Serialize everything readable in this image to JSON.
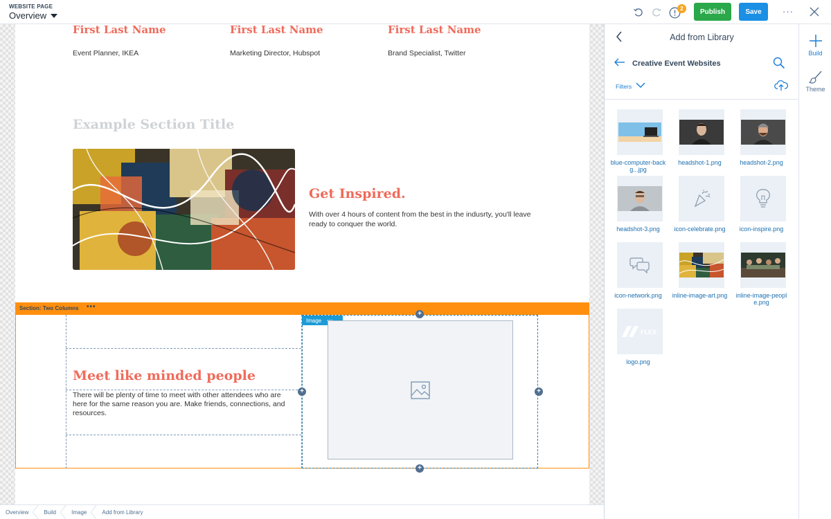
{
  "header": {
    "kicker": "WEBSITE PAGE",
    "page_select": "Overview",
    "badge_count": "2",
    "publish_label": "Publish",
    "save_label": "Save",
    "more_label": "···",
    "colors": {
      "publish": "#2ba84a",
      "save": "#1a8fe3",
      "badge": "#f5a623"
    }
  },
  "page": {
    "speakers": [
      {
        "name": "First Last Name",
        "role": "Event Planner, IKEA"
      },
      {
        "name": "First Last Name",
        "role": "Marketing Director, Hubspot"
      },
      {
        "name": "First Last Name",
        "role": "Brand Specialist, Twitter"
      }
    ],
    "section_title": "Example Section Title",
    "inspired_title": "Get Inspired.",
    "inspired_text": "With over 4 hours of content from the best in the indusrty, you'll leave ready to conquer the world.",
    "section_label": "Section: Two Columns",
    "section_menu": "•••",
    "meet_title": "Meet like minded people",
    "meet_text": "There will be plenty of time to meet with other attendees who are here for the same reason you are. Make friends, connections, and resources.",
    "image_tag": "Image",
    "image_menu": "•••",
    "colors": {
      "heading": "#ef6b5b",
      "section_bar": "#ff8f0f",
      "image_border": "#2e7ea3"
    }
  },
  "breadcrumbs": [
    "Overview",
    "Build",
    "Image",
    "Add from Library"
  ],
  "library": {
    "title": "Add from Library",
    "folder": "Creative Event Websites",
    "filters_label": "Filters",
    "files": [
      {
        "name": "blue-computer-backg...jpg",
        "thumb": "computer"
      },
      {
        "name": "headshot-1.png",
        "thumb": "headshot-1"
      },
      {
        "name": "headshot-2.png",
        "thumb": "headshot-2"
      },
      {
        "name": "headshot-3.png",
        "thumb": "headshot-3"
      },
      {
        "name": "icon-celebrate.png",
        "thumb": "celebrate-icon"
      },
      {
        "name": "icon-inspire.png",
        "thumb": "lightbulb-icon"
      },
      {
        "name": "icon-network.png",
        "thumb": "chat-bubbles-icon"
      },
      {
        "name": "inline-image-art.png",
        "thumb": "art"
      },
      {
        "name": "inline-image-people.png",
        "thumb": "people"
      },
      {
        "name": "logo.png",
        "thumb": "flex-logo"
      }
    ]
  },
  "rail": {
    "build_label": "Build",
    "theme_label": "Theme"
  }
}
